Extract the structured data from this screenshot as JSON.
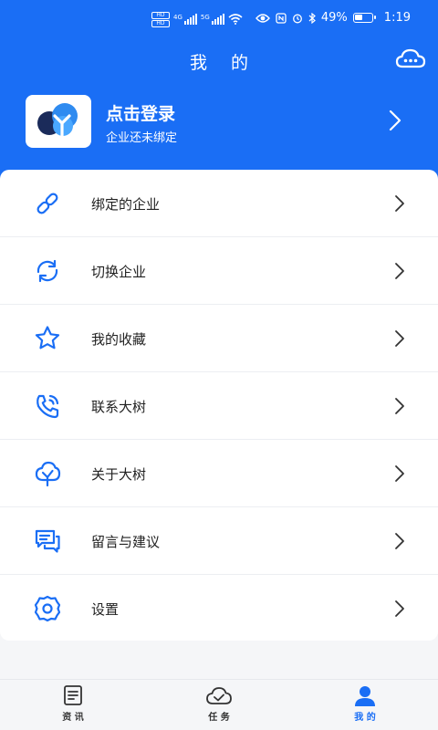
{
  "status_bar": {
    "hd_1": "HD",
    "hd_2": "HD",
    "sig_1": "4G",
    "sig_2": "5G",
    "battery_percent": "49%",
    "battery_level": 0.49,
    "time": "1:19"
  },
  "header": {
    "title": "我 的"
  },
  "profile": {
    "login_text": "点击登录",
    "subtitle": "企业还未绑定"
  },
  "menu": [
    {
      "label": "绑定的企业",
      "icon": "link-icon"
    },
    {
      "label": "切换企业",
      "icon": "switch-icon"
    },
    {
      "label": "我的收藏",
      "icon": "star-icon"
    },
    {
      "label": "联系大树",
      "icon": "phone-icon"
    },
    {
      "label": "关于大树",
      "icon": "tree-icon"
    },
    {
      "label": "留言与建议",
      "icon": "message-icon"
    },
    {
      "label": "设置",
      "icon": "gear-icon"
    }
  ],
  "bottom_nav": {
    "tabs": [
      {
        "label": "资 讯",
        "icon": "news-icon"
      },
      {
        "label": "任 务",
        "icon": "task-icon"
      },
      {
        "label": "我 的",
        "icon": "profile-icon",
        "active": true
      }
    ]
  },
  "colors": {
    "primary": "#1a6ef5",
    "background": "#f5f6f8",
    "text": "#222222"
  }
}
